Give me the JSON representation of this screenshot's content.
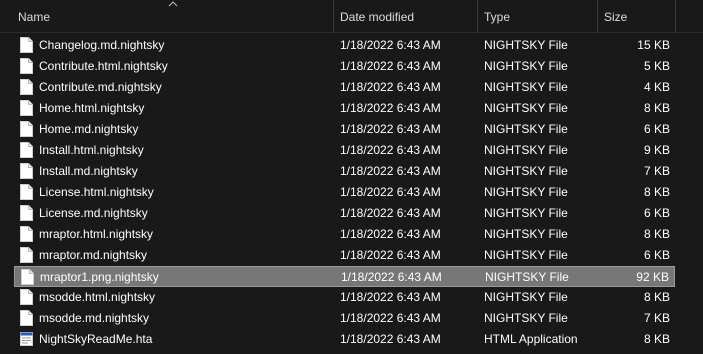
{
  "columns": {
    "name": "Name",
    "date_modified": "Date modified",
    "type": "Type",
    "size": "Size"
  },
  "sort_indicator": "chevron-up-icon",
  "files": [
    {
      "name": "Changelog.md.nightsky",
      "date": "1/18/2022 6:43 AM",
      "type": "NIGHTSKY File",
      "size": "15 KB",
      "icon": "file-icon"
    },
    {
      "name": "Contribute.html.nightsky",
      "date": "1/18/2022 6:43 AM",
      "type": "NIGHTSKY File",
      "size": "5 KB",
      "icon": "file-icon"
    },
    {
      "name": "Contribute.md.nightsky",
      "date": "1/18/2022 6:43 AM",
      "type": "NIGHTSKY File",
      "size": "4 KB",
      "icon": "file-icon"
    },
    {
      "name": "Home.html.nightsky",
      "date": "1/18/2022 6:43 AM",
      "type": "NIGHTSKY File",
      "size": "8 KB",
      "icon": "file-icon"
    },
    {
      "name": "Home.md.nightsky",
      "date": "1/18/2022 6:43 AM",
      "type": "NIGHTSKY File",
      "size": "6 KB",
      "icon": "file-icon"
    },
    {
      "name": "Install.html.nightsky",
      "date": "1/18/2022 6:43 AM",
      "type": "NIGHTSKY File",
      "size": "9 KB",
      "icon": "file-icon"
    },
    {
      "name": "Install.md.nightsky",
      "date": "1/18/2022 6:43 AM",
      "type": "NIGHTSKY File",
      "size": "7 KB",
      "icon": "file-icon"
    },
    {
      "name": "License.html.nightsky",
      "date": "1/18/2022 6:43 AM",
      "type": "NIGHTSKY File",
      "size": "8 KB",
      "icon": "file-icon"
    },
    {
      "name": "License.md.nightsky",
      "date": "1/18/2022 6:43 AM",
      "type": "NIGHTSKY File",
      "size": "6 KB",
      "icon": "file-icon"
    },
    {
      "name": "mraptor.html.nightsky",
      "date": "1/18/2022 6:43 AM",
      "type": "NIGHTSKY File",
      "size": "8 KB",
      "icon": "file-icon"
    },
    {
      "name": "mraptor.md.nightsky",
      "date": "1/18/2022 6:43 AM",
      "type": "NIGHTSKY File",
      "size": "6 KB",
      "icon": "file-icon"
    },
    {
      "name": "mraptor1.png.nightsky",
      "date": "1/18/2022 6:43 AM",
      "type": "NIGHTSKY File",
      "size": "92 KB",
      "icon": "file-icon",
      "selected": true
    },
    {
      "name": "msodde.html.nightsky",
      "date": "1/18/2022 6:43 AM",
      "type": "NIGHTSKY File",
      "size": "8 KB",
      "icon": "file-icon"
    },
    {
      "name": "msodde.md.nightsky",
      "date": "1/18/2022 6:43 AM",
      "type": "NIGHTSKY File",
      "size": "7 KB",
      "icon": "file-icon"
    },
    {
      "name": "NightSkyReadMe.hta",
      "date": "1/18/2022 6:43 AM",
      "type": "HTML Application",
      "size": "8 KB",
      "icon": "html-application-icon"
    }
  ],
  "colors": {
    "background": "#191919",
    "selected_row": "#777777",
    "text": "#ffffff"
  }
}
